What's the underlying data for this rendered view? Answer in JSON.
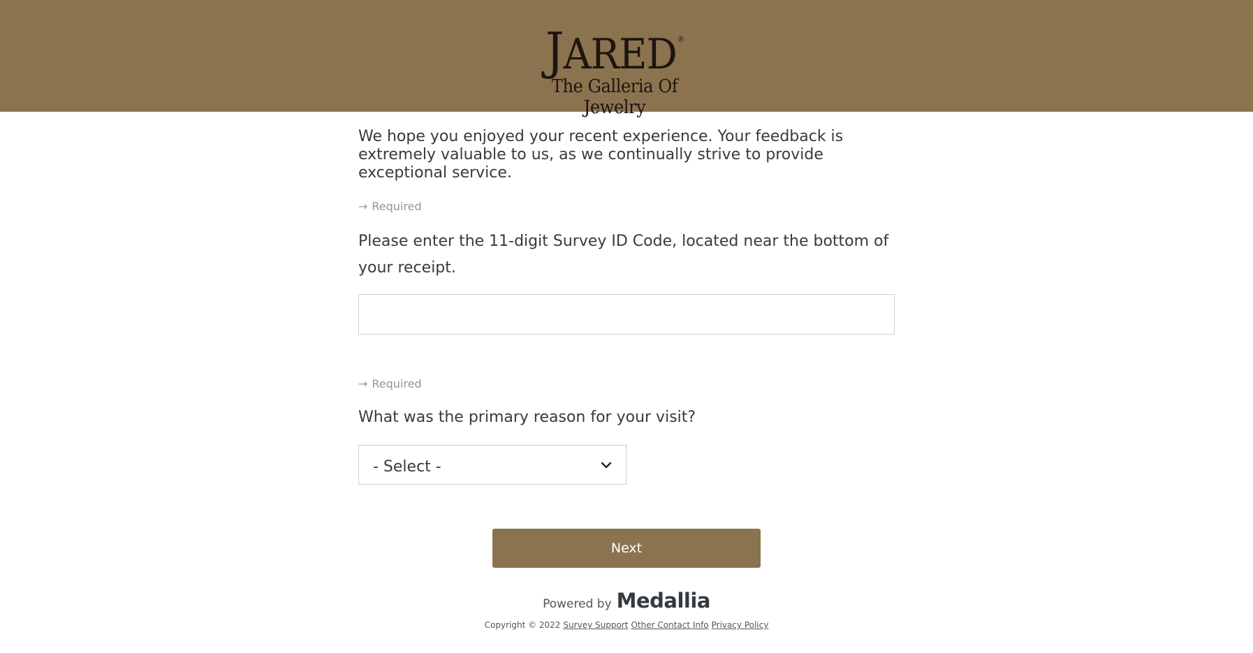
{
  "header": {
    "logo_main_initial": "J",
    "logo_main_rest": "ARED",
    "logo_registered": "®",
    "logo_subtitle": "The Galleria Of Jewelry"
  },
  "intro": "We hope you enjoyed your recent experience. Your feedback is extremely valuable to us, as we continually strive to provide exceptional service.",
  "questions": [
    {
      "required_label": "Required",
      "text": "Please enter the 11-digit Survey ID Code, located near the bottom of your receipt.",
      "input_value": ""
    },
    {
      "required_label": "Required",
      "text": "What was the primary reason for your visit?",
      "selected_value": "- Select -"
    }
  ],
  "next_button": "Next",
  "powered_by": {
    "text": "Powered by",
    "brand": "Medallia"
  },
  "footer": {
    "copyright": "Copyright © 2022",
    "links": [
      "Survey Support",
      "Other Contact Info",
      "Privacy Policy"
    ]
  },
  "colors": {
    "brand_gold": "#8b7350",
    "text": "#3a3a3a",
    "required": "#959595"
  },
  "icons": {
    "required": "arrow-right-icon",
    "select": "chevron-down-icon"
  }
}
